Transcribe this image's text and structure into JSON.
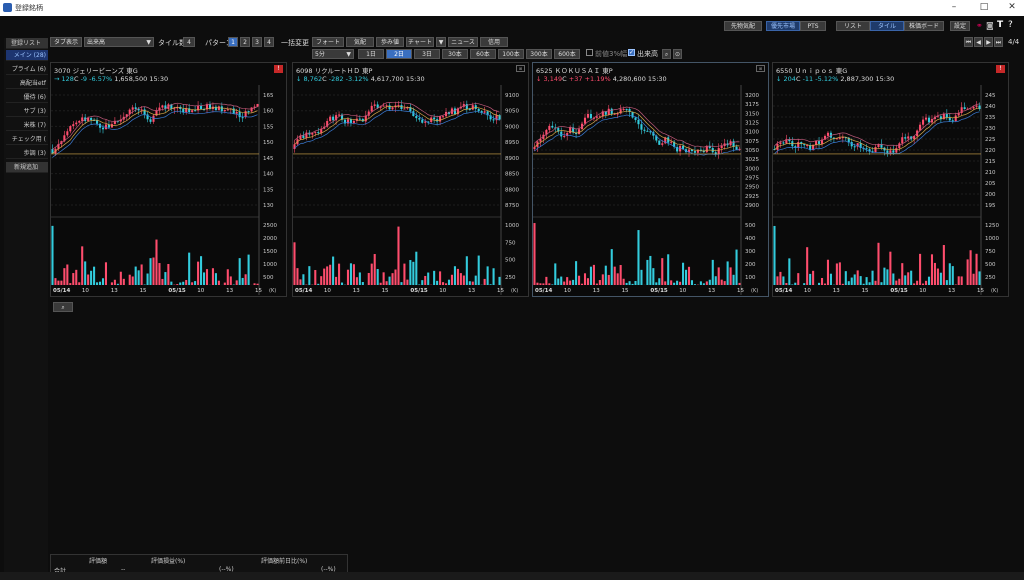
{
  "window": {
    "title": "登録銘柄"
  },
  "topbar": {
    "toolbar_buttons": [
      "先物気配",
      "優先市場",
      "PTS",
      "リスト",
      "タイル",
      "株価ボード",
      "設定"
    ],
    "page": "4/4"
  },
  "toolbar": {
    "tab_display_label": "タブ表示",
    "sort_value": "出来高",
    "tile_count_label": "タイル数",
    "tile_count": "4",
    "pattern_label": "パターン",
    "patterns": [
      "1",
      "2",
      "3",
      "4"
    ],
    "bulk_change_label": "一括変更",
    "view_buttons": [
      "フォート",
      "気配",
      "歩み値",
      "チャート",
      "ニュース",
      "信用"
    ],
    "interval": "5分",
    "ranges": [
      "1日",
      "2日",
      "3日",
      "30本",
      "60本",
      "100本",
      "300本",
      "600本"
    ],
    "check1": "前値3%幅",
    "check2": "出来高"
  },
  "sidebar": {
    "header": "登録リスト",
    "items": [
      "メイン (28)",
      "プライム (6)",
      "高配当etf",
      "優待 (6)",
      "サブ (3)",
      "米株 (7)",
      "チェック用 (",
      "歩調 (3)"
    ],
    "add": "新規追加"
  },
  "panes": [
    {
      "code": "3070",
      "name": "ジェリービーンズ",
      "market": "東G",
      "arrow": "→",
      "price": "128",
      "flag": "C",
      "change": "-9",
      "pct": "-6.57%",
      "volume": "1,658,500",
      "time": "15:30",
      "dir": "dn",
      "alarm": true,
      "price_ticks": [
        "165",
        "160",
        "155",
        "150",
        "145",
        "140",
        "135",
        "130"
      ],
      "vol_ticks": [
        "2500",
        "2000",
        "1500",
        "1000",
        "500"
      ],
      "x_ticks": [
        "05/14",
        "10",
        "13",
        "15",
        "05/15",
        "10",
        "13",
        "15"
      ],
      "unit": "(K)"
    },
    {
      "code": "6098",
      "name": "リクルートＨＤ",
      "market": "東P",
      "arrow": "↓",
      "price": "8,762",
      "flag": "C",
      "change": "-282",
      "pct": "-3.12%",
      "volume": "4,617,700",
      "time": "15:30",
      "dir": "dn",
      "alarm": false,
      "price_ticks": [
        "9100",
        "9050",
        "9000",
        "8950",
        "8900",
        "8850",
        "8800",
        "8750"
      ],
      "vol_ticks": [
        "1000",
        "750",
        "500",
        "250"
      ],
      "x_ticks": [
        "05/14",
        "10",
        "13",
        "15",
        "05/15",
        "10",
        "13",
        "15"
      ],
      "unit": "(K)"
    },
    {
      "code": "6525",
      "name": "ＫＯＫＵＳＡＩ",
      "market": "東P",
      "arrow": "↓",
      "price": "3,149",
      "flag": "C",
      "change": "+37",
      "pct": "+1.19%",
      "volume": "4,280,600",
      "time": "15:30",
      "dir": "up",
      "alarm": false,
      "price_ticks": [
        "3200",
        "3175",
        "3150",
        "3125",
        "3100",
        "3075",
        "3050",
        "3025",
        "3000",
        "2975",
        "2950",
        "2925",
        "2900"
      ],
      "vol_ticks": [
        "500",
        "400",
        "300",
        "200",
        "100"
      ],
      "x_ticks": [
        "05/14",
        "10",
        "13",
        "15",
        "05/15",
        "10",
        "13",
        "15"
      ],
      "unit": "(K)"
    },
    {
      "code": "6550",
      "name": "Ｕｎｉｐｏｓ",
      "market": "東G",
      "arrow": "↓",
      "price": "204",
      "flag": "C",
      "change": "-11",
      "pct": "-5.12%",
      "volume": "2,887,300",
      "time": "15:30",
      "dir": "dn",
      "alarm": true,
      "price_ticks": [
        "245",
        "240",
        "235",
        "230",
        "225",
        "220",
        "215",
        "210",
        "205",
        "200",
        "195"
      ],
      "vol_ticks": [
        "1250",
        "1000",
        "750",
        "500",
        "250"
      ],
      "x_ticks": [
        "05/14",
        "10",
        "13",
        "15",
        "05/15",
        "10",
        "13",
        "15"
      ],
      "unit": "(K)"
    }
  ],
  "bottom": {
    "headers": [
      "評価額",
      "評価損益(%)",
      "評価額前日比(%)"
    ],
    "row_label": "合計",
    "values": [
      "--",
      "(--%)",
      "(--%)"
    ]
  },
  "colors": {
    "up": "#ff4d6d",
    "down": "#33ccdd",
    "ma1": "#d4a84a",
    "ma2": "#3a7bd5",
    "ma3": "#c05a7a",
    "accent": "#3a6fc0"
  }
}
